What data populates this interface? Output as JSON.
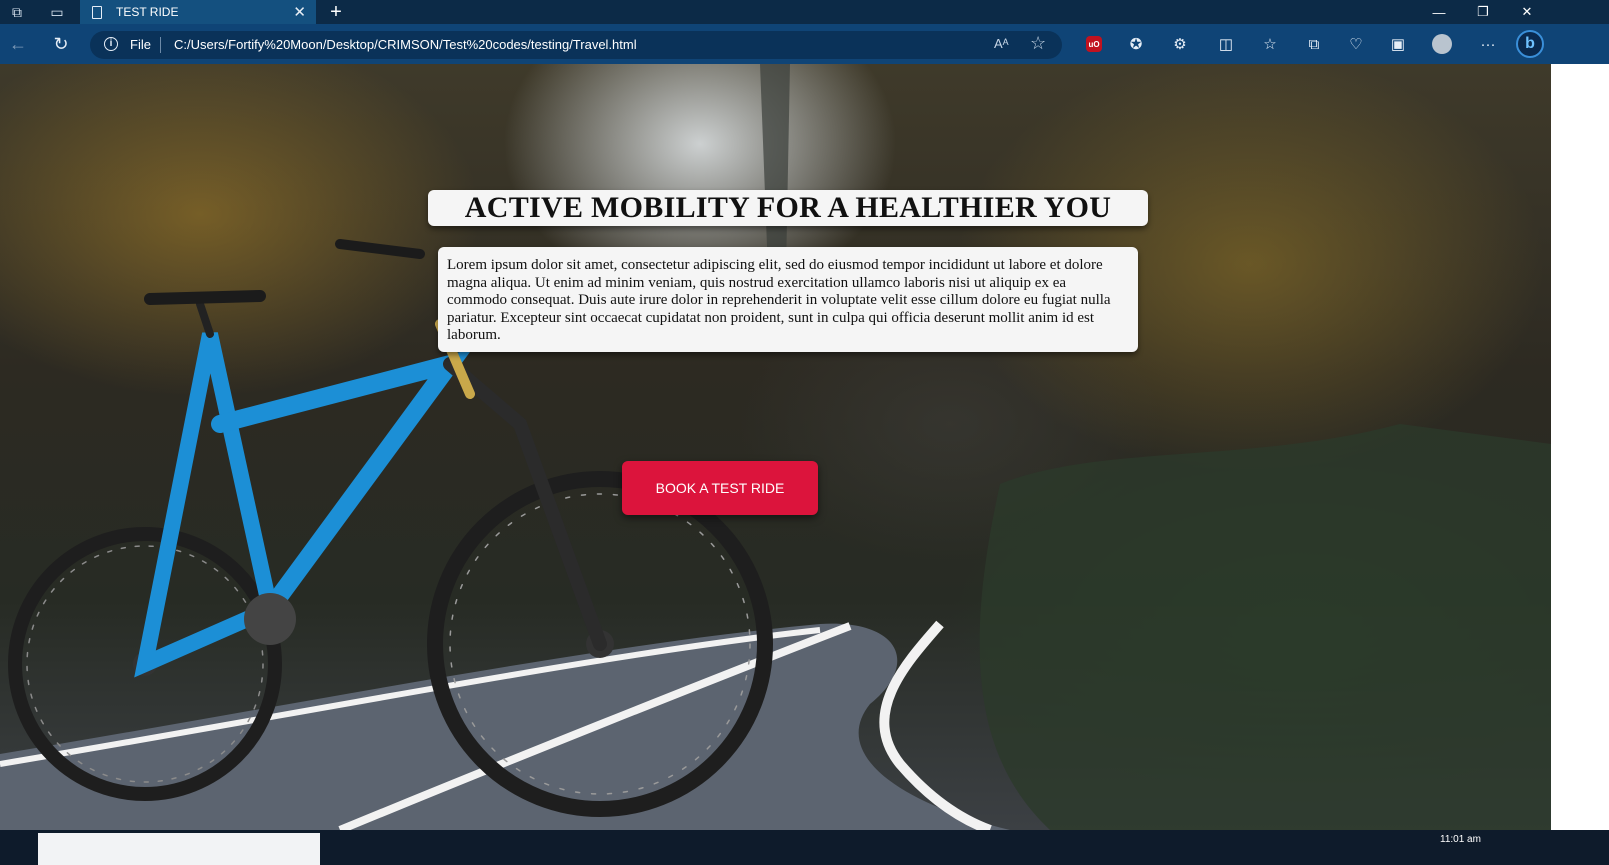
{
  "browser": {
    "tab_title": "TEST RIDE",
    "tab_close_glyph": "✕",
    "new_tab_glyph": "+",
    "address": {
      "scheme_label": "File",
      "url": "C:/Users/Fortify%20Moon/Desktop/CRIMSON/Test%20codes/testing/Travel.html"
    },
    "icons": [
      "workspaces-icon",
      "tab-actions-icon",
      "back-icon",
      "refresh-icon",
      "info-icon",
      "read-aloud-icon",
      "favorite-star-icon",
      "ublock-icon",
      "extension-icon",
      "puzzle-icon",
      "split-screen-icon",
      "favorites-icon",
      "collections-icon",
      "performance-icon",
      "edge-bar-icon",
      "profile-avatar-icon",
      "more-icon",
      "bing-icon"
    ]
  },
  "page": {
    "headline": "ACTIVE MOBILITY FOR A HEALTHIER YOU",
    "description": "Lorem ipsum dolor sit amet, consectetur adipiscing elit, sed do eiusmod tempor incididunt ut labore et dolore magna aliqua. Ut enim ad minim veniam, quis nostrud exercitation ullamco laboris nisi ut aliquip ex ea commodo consequat. Duis aute irure dolor in reprehenderit in voluptate velit esse cillum dolore eu fugiat nulla pariatur. Excepteur sint occaecat cupidatat non proident, sunt in culpa qui officia deserunt mollit anim id est laborum.",
    "cta_label": "BOOK A TEST RIDE",
    "colors": {
      "cta": "#dc143c",
      "card": "#f5f5f5"
    }
  },
  "taskbar": {
    "clock": "11:01 am"
  }
}
